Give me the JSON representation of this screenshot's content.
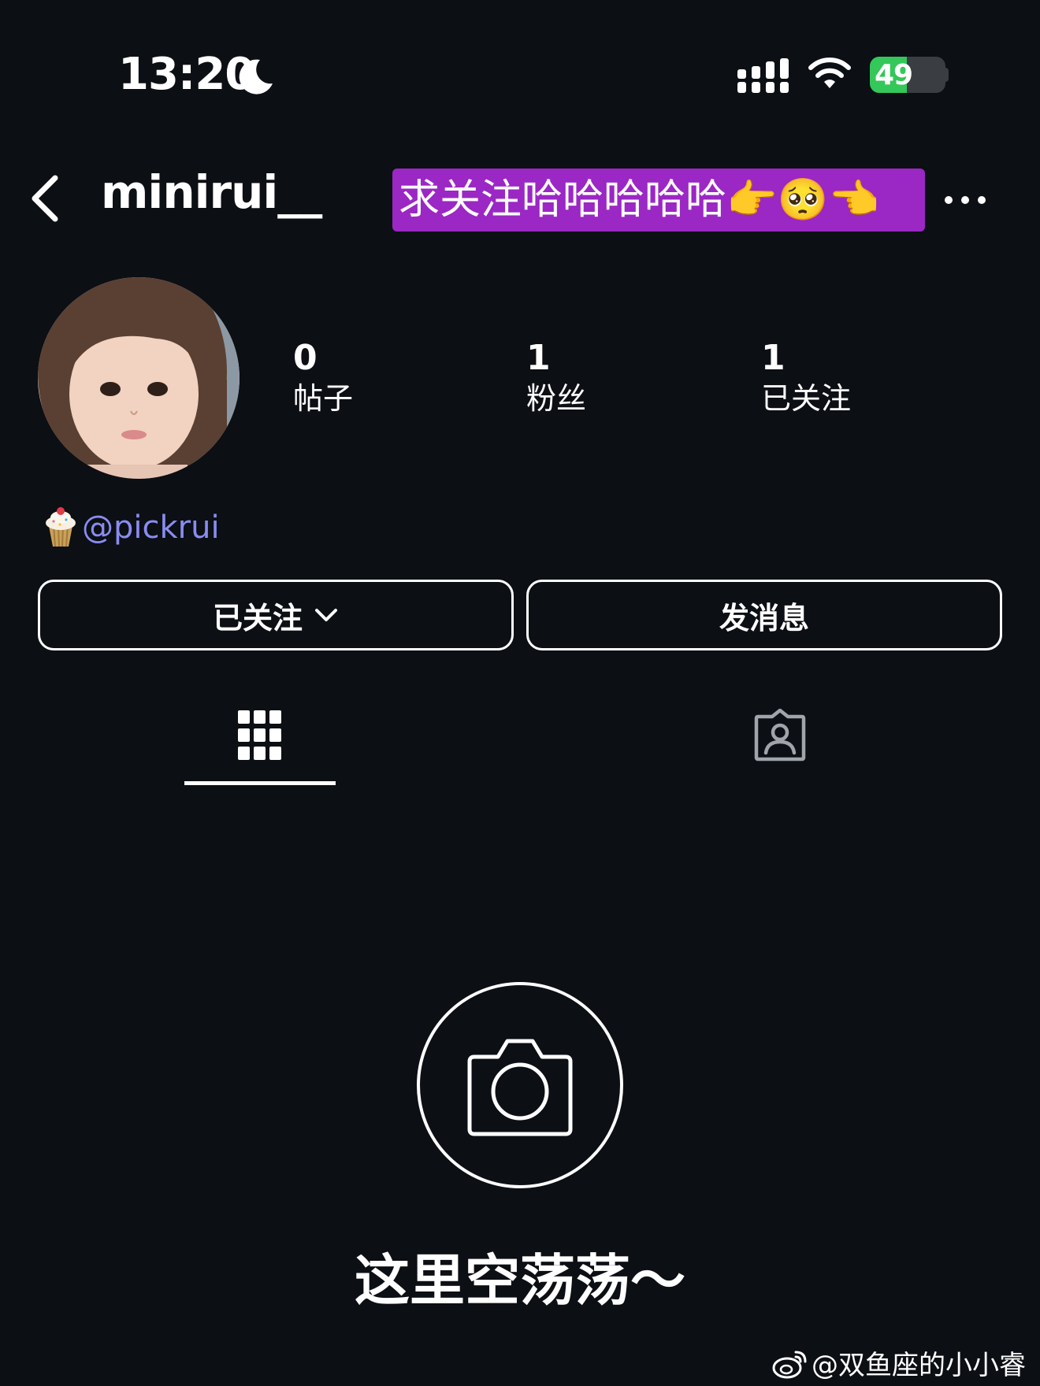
{
  "status_bar": {
    "time": "13:20",
    "battery_level": "49",
    "battery_fraction": 0.49
  },
  "header": {
    "username": "minirui__",
    "promo_text": "求关注哈哈哈哈哈👉🥺👈"
  },
  "stats": [
    {
      "value": "0",
      "label": "帖子"
    },
    {
      "value": "1",
      "label": "粉丝"
    },
    {
      "value": "1",
      "label": "已关注"
    }
  ],
  "bio": {
    "link": "@pickrui"
  },
  "actions": {
    "following": "已关注",
    "message": "发消息"
  },
  "empty_state": {
    "text": "这里空荡荡～"
  },
  "watermark": {
    "text": "@双鱼座的小小睿"
  },
  "colors": {
    "background": "#0c0f14",
    "promo_bg": "#9b27c4",
    "link": "#8a8cf0",
    "battery": "#34c759"
  },
  "icons": [
    "moon-icon",
    "signal-icon",
    "wifi-icon",
    "battery-icon",
    "back-icon",
    "more-icon",
    "cupcake-icon",
    "chevron-down-icon",
    "grid-icon",
    "tagged-icon",
    "camera-icon",
    "weibo-icon"
  ]
}
